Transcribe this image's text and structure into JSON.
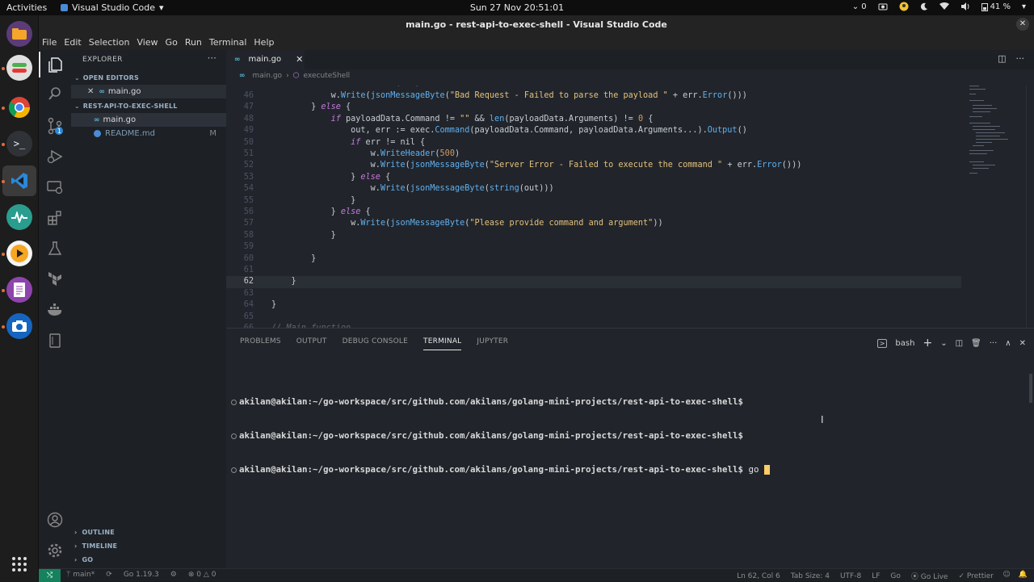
{
  "topbar": {
    "activities": "Activities",
    "app_name": "Visual Studio Code",
    "datetime": "Sun 27 Nov  20:51:01",
    "notification_count": "0",
    "battery": "41 %"
  },
  "window": {
    "title": "main.go - rest-api-to-exec-shell - Visual Studio Code"
  },
  "menu": [
    "File",
    "Edit",
    "Selection",
    "View",
    "Go",
    "Run",
    "Terminal",
    "Help"
  ],
  "sidebar": {
    "title": "EXPLORER",
    "open_editors": "OPEN EDITORS",
    "open_file": "main.go",
    "project": "REST-API-TO-EXEC-SHELL",
    "files": [
      {
        "name": "main.go",
        "badge": ""
      },
      {
        "name": "README.md",
        "badge": "M"
      }
    ],
    "bottom": [
      "OUTLINE",
      "TIMELINE",
      "GO"
    ]
  },
  "editor": {
    "tab": "main.go",
    "breadcrumb_file": "main.go",
    "breadcrumb_symbol": "executeShell",
    "current_line": "62"
  },
  "panel": {
    "tabs": [
      "PROBLEMS",
      "OUTPUT",
      "DEBUG CONSOLE",
      "TERMINAL",
      "JUPYTER"
    ],
    "shell": "bash",
    "lines": [
      {
        "user": "akilan@akilan",
        "path": ":~/go-workspace/src/github.com/akilans/golang-mini-projects/rest-api-to-exec-shell$",
        "cmd": ""
      },
      {
        "user": "akilan@akilan",
        "path": ":~/go-workspace/src/github.com/akilans/golang-mini-projects/rest-api-to-exec-shell$",
        "cmd": ""
      },
      {
        "user": "akilan@akilan",
        "path": ":~/go-workspace/src/github.com/akilans/golang-mini-projects/rest-api-to-exec-shell$",
        "cmd": " go"
      }
    ]
  },
  "status": {
    "branch": "main*",
    "go_version": "Go 1.19.3",
    "errors": "0",
    "warnings": "0",
    "position": "Ln 62, Col 6",
    "tab_size": "Tab Size: 4",
    "encoding": "UTF-8",
    "eol": "LF",
    "language": "Go",
    "go_live": "Go Live",
    "prettier": "Prettier"
  },
  "colors": {
    "accent": "#16825d",
    "cursor": "#ffcc66",
    "keyword": "#c678dd",
    "function": "#61afef",
    "string": "#e5c07b",
    "number": "#d19a66"
  }
}
